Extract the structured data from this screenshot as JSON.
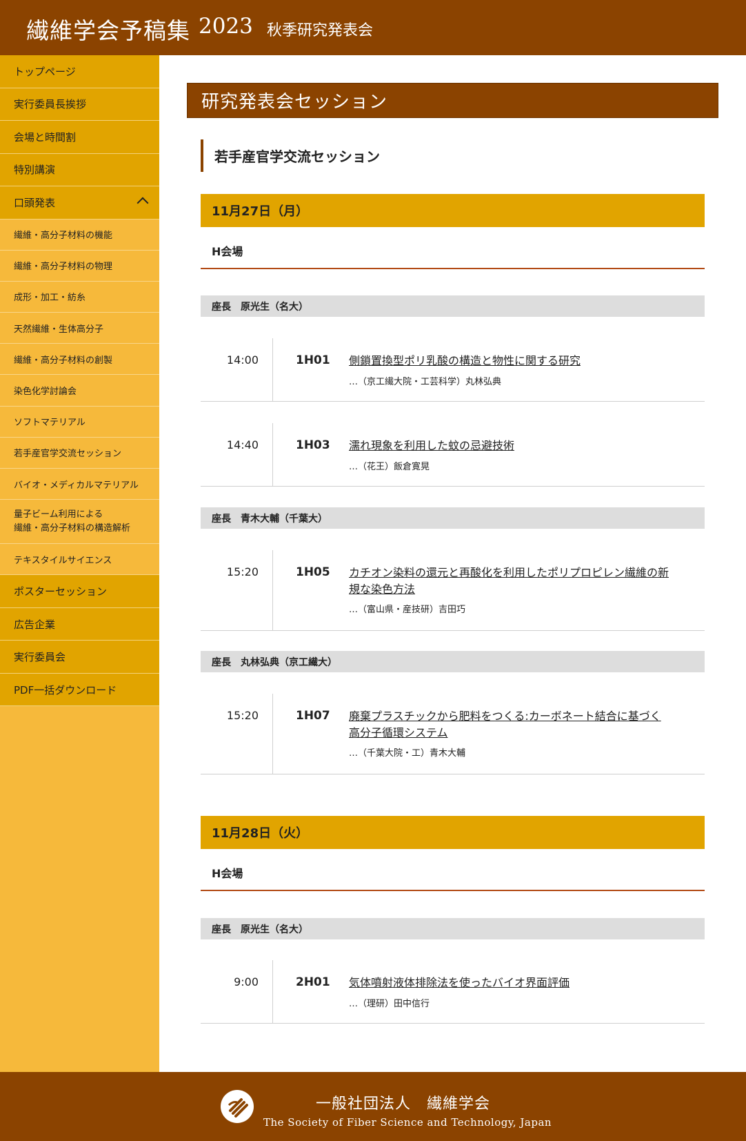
{
  "header": {
    "title": "繊維学会予稿集",
    "year": "2023",
    "event": "秋季研究発表会"
  },
  "sidebar": {
    "items": [
      {
        "label": "トップページ"
      },
      {
        "label": "実行委員長挨拶"
      },
      {
        "label": "会場と時間割"
      },
      {
        "label": "特別講演"
      },
      {
        "label": "口頭発表"
      }
    ],
    "sub_items": [
      {
        "label": "繊維・高分子材料の機能"
      },
      {
        "label": "繊維・高分子材料の物理"
      },
      {
        "label": "成形・加工・紡糸"
      },
      {
        "label": "天然繊維・生体高分子"
      },
      {
        "label": "繊維・高分子材料の創製"
      },
      {
        "label": "染色化学討論会"
      },
      {
        "label": "ソフトマテリアル"
      },
      {
        "label": "若手産官学交流セッション"
      },
      {
        "label": "バイオ・メディカルマテリアル"
      },
      {
        "label_line1": "量子ビーム利用による",
        "label_line2": "繊維・高分子材料の構造解析"
      },
      {
        "label": "テキスタイルサイエンス"
      }
    ],
    "bottom_items": [
      {
        "label": "ポスターセッション"
      },
      {
        "label": "広告企業"
      },
      {
        "label": "実行委員会"
      },
      {
        "label": "PDF一括ダウンロード"
      }
    ]
  },
  "main": {
    "section_title": "研究発表会セッション",
    "subsection_title": "若手産官学交流セッション",
    "days": [
      {
        "date": "11月27日（月）",
        "room": "H会場",
        "chairs": [
          "座長　原光生（名大）",
          "座長　青木大輔（千葉大）",
          "座長　丸林弘典（京工繊大）"
        ],
        "entries": [
          {
            "time": "14:00",
            "code": "1H01",
            "title": "側鎖置換型ポリ乳酸の構造と物性に関する研究",
            "author": "…（京工繊大院・工芸科学）丸林弘典"
          },
          {
            "time": "14:40",
            "code": "1H03",
            "title": "濡れ現象を利用した蚊の忌避技術",
            "author": "…（花王）飯倉寛晃"
          },
          {
            "time": "15:20",
            "code": "1H05",
            "title": "カチオン染料の還元と再酸化を利用したポリプロピレン繊維の新規な染色方法",
            "author": "…（富山県・産技研）吉田巧"
          },
          {
            "time": "15:20",
            "code": "1H07",
            "title": "廃棄プラスチックから肥料をつくる:カーボネート結合に基づく高分子循環システム",
            "author": "…（千葉大院・工）青木大輔"
          }
        ]
      },
      {
        "date": "11月28日（火）",
        "room": "H会場",
        "chairs": [
          "座長　原光生（名大）"
        ],
        "entries": [
          {
            "time": "9:00",
            "code": "2H01",
            "title": "気体噴射液体排除法を使ったバイオ界面評価",
            "author": "…（理研）田中信行"
          }
        ]
      }
    ]
  },
  "footer": {
    "name_jp": "一般社団法人　繊維学会",
    "name_en": "The Society of Fiber Science and Technology, Japan"
  },
  "colors": {
    "brand_brown": "#8B4300",
    "gold": "#E1A400",
    "light_gold": "#F6B93B",
    "chair_gray": "#DDDDDD"
  }
}
